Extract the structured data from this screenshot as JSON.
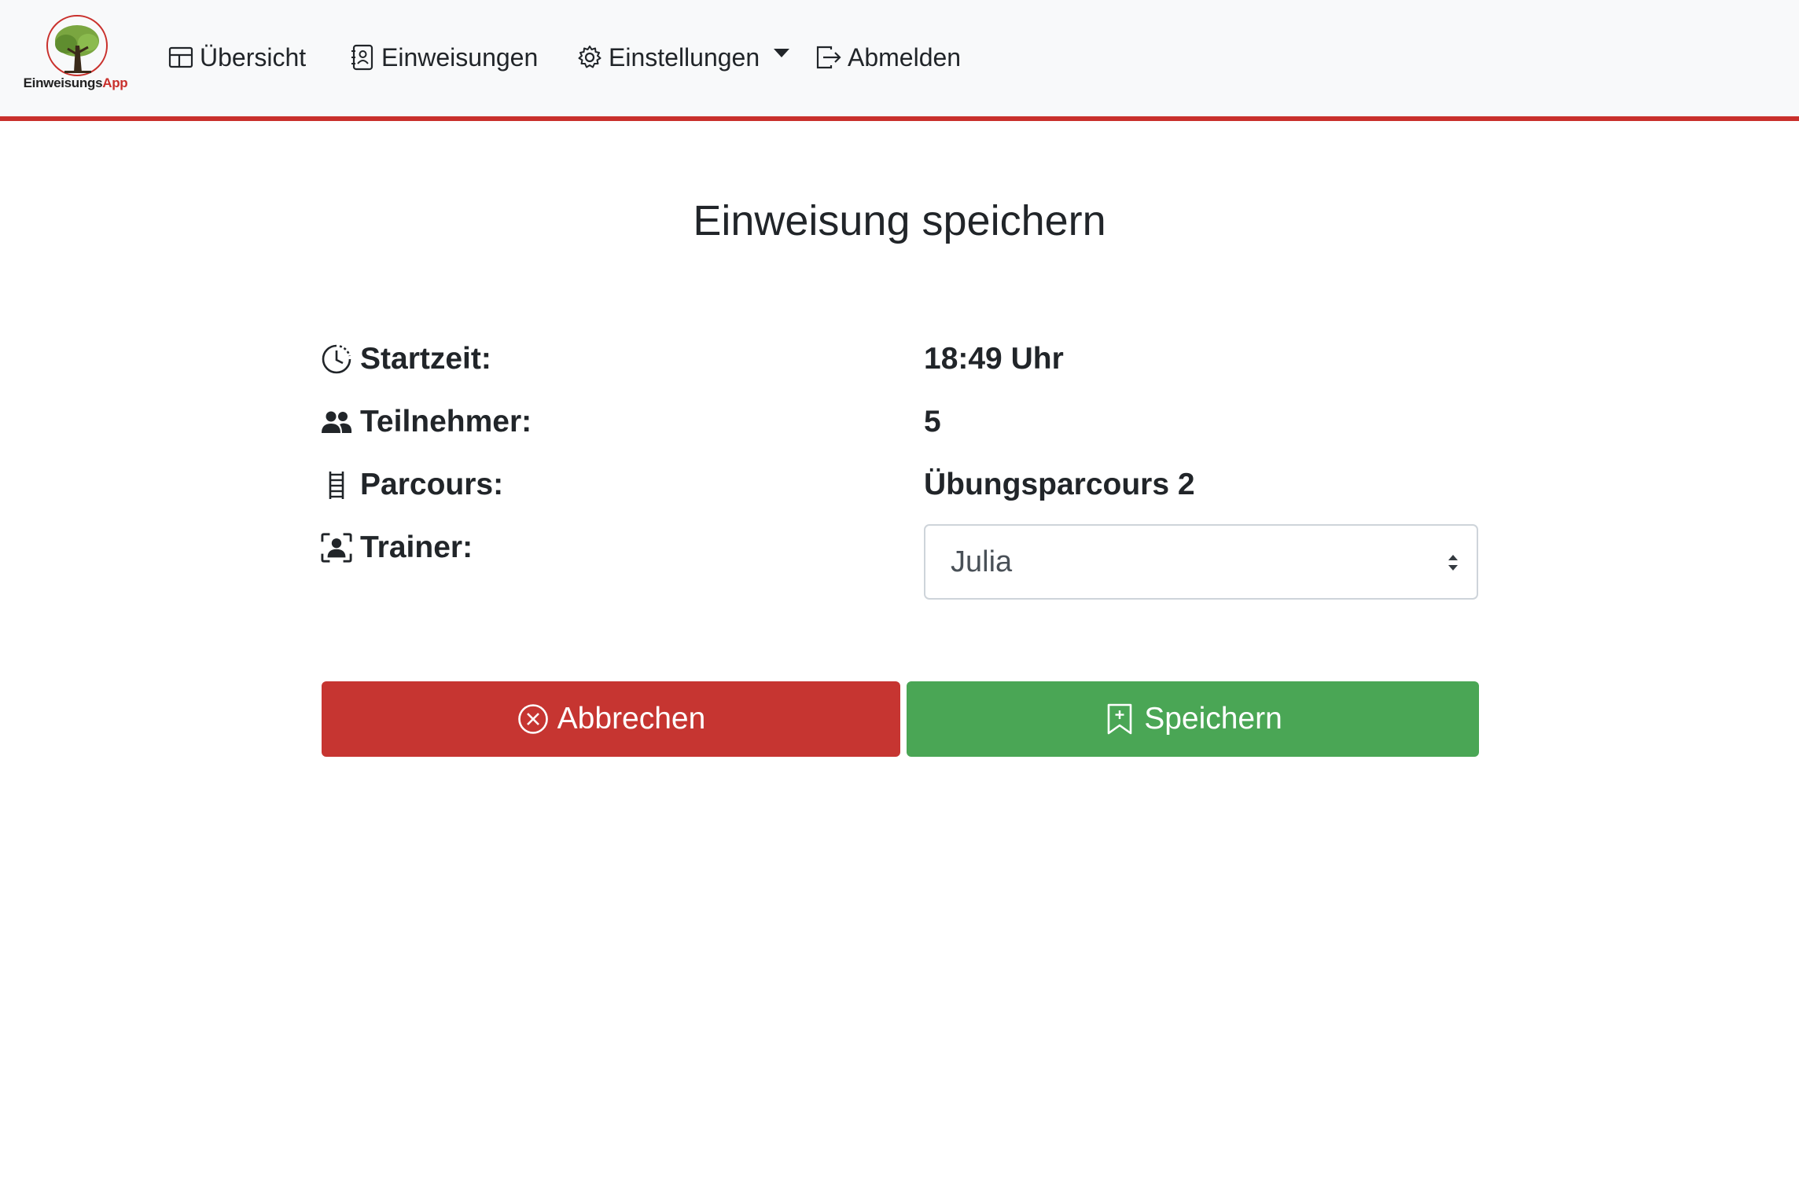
{
  "app": {
    "logo_text_main": "Einweisungs",
    "logo_text_accent": "App",
    "accent_color": "#c9302c"
  },
  "nav": {
    "items": [
      {
        "label": "Übersicht",
        "icon": "layout-icon"
      },
      {
        "label": "Einweisungen",
        "icon": "contact-book-icon"
      },
      {
        "label": "Einstellungen",
        "icon": "gear-icon"
      },
      {
        "label": "Abmelden",
        "icon": "logout-icon"
      }
    ]
  },
  "main": {
    "title": "Einweisung speichern",
    "fields": {
      "start_label": "Startzeit:",
      "start_value": "18:49 Uhr",
      "participants_label": "Teilnehmer:",
      "participants_value": "5",
      "course_label": "Parcours:",
      "course_value": "Übungsparcours 2",
      "trainer_label": "Trainer:",
      "trainer_selected": "Julia"
    },
    "buttons": {
      "cancel_label": "Abbrechen",
      "cancel_color": "#c63531",
      "save_label": "Speichern",
      "save_color": "#4aa655"
    }
  }
}
